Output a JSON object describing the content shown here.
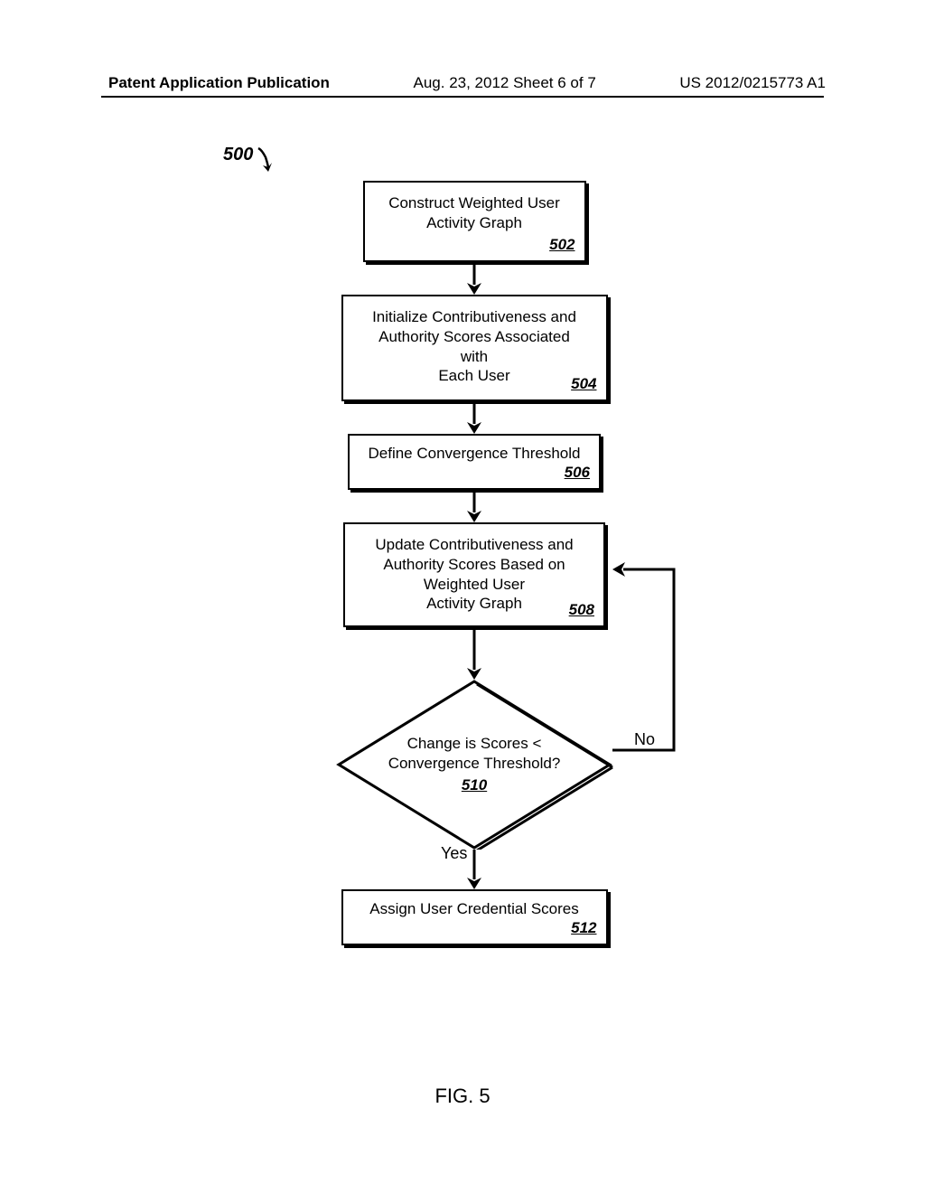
{
  "header": {
    "left": "Patent Application Publication",
    "center": "Aug. 23, 2012  Sheet 6 of 7",
    "right": "US 2012/0215773 A1"
  },
  "ref500": "500",
  "boxes": {
    "b502": {
      "text": "Construct Weighted User\nActivity Graph",
      "ref": "502"
    },
    "b504": {
      "text": "Initialize Contributiveness and\nAuthority Scores Associated\nwith\nEach User",
      "ref": "504"
    },
    "b506": {
      "text": "Define Convergence Threshold",
      "ref": "506"
    },
    "b508": {
      "text": "Update Contributiveness and\nAuthority Scores Based on\nWeighted User\nActivity Graph",
      "ref": "508"
    },
    "b510": {
      "text": "Change is Scores <\nConvergence Threshold?",
      "ref": "510"
    },
    "b512": {
      "text": "Assign User Credential Scores",
      "ref": "512"
    }
  },
  "labels": {
    "no": "No",
    "yes": "Yes"
  },
  "figure": "FIG. 5"
}
